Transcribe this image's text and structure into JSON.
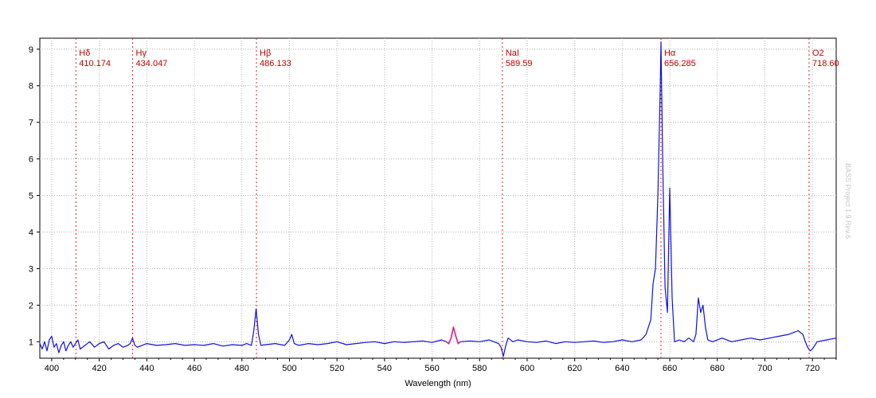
{
  "chart_data": {
    "type": "line",
    "xlabel": "Wavelength (nm)",
    "ylabel": "",
    "xlim": [
      395,
      730
    ],
    "ylim": [
      0.55,
      9.3
    ],
    "grid": true,
    "xticks": [
      400,
      420,
      440,
      460,
      480,
      500,
      520,
      540,
      560,
      580,
      600,
      620,
      640,
      660,
      680,
      700,
      720
    ],
    "yticks": [
      1,
      2,
      3,
      4,
      5,
      6,
      7,
      8,
      9
    ],
    "watermark": "BASS Project 1.9 Rev.6",
    "reference_lines": [
      {
        "name": "Hδ",
        "wavelength_label": "410.174",
        "x": 410.174
      },
      {
        "name": "Hγ",
        "wavelength_label": "434.047",
        "x": 434.047
      },
      {
        "name": "Hβ",
        "wavelength_label": "486.133",
        "x": 486.133
      },
      {
        "name": "NaI",
        "wavelength_label": "589.59",
        "x": 589.59
      },
      {
        "name": "Hα",
        "wavelength_label": "656.285",
        "x": 656.285
      },
      {
        "name": "O2",
        "wavelength_label": "718.60",
        "x": 718.6
      }
    ],
    "series": [
      {
        "x": [
          395,
          396,
          397,
          398,
          399,
          400,
          401,
          402,
          403,
          404,
          405,
          406,
          407,
          408,
          409,
          410,
          411,
          412,
          414,
          416,
          418,
          420,
          422,
          424,
          426,
          428,
          430,
          432,
          433,
          434,
          435,
          436,
          438,
          440,
          444,
          448,
          452,
          456,
          460,
          464,
          468,
          472,
          476,
          480,
          482,
          484,
          485,
          486,
          487,
          488,
          490,
          494,
          498,
          500,
          501,
          502,
          504,
          508,
          512,
          516,
          520,
          524,
          528,
          532,
          536,
          540,
          544,
          548,
          552,
          556,
          560,
          564,
          566,
          567,
          568,
          569,
          570,
          571,
          572,
          576,
          580,
          584,
          586,
          588,
          589,
          590,
          591,
          592,
          594,
          596,
          600,
          604,
          608,
          612,
          616,
          620,
          624,
          628,
          632,
          636,
          640,
          644,
          648,
          650,
          652,
          653,
          654,
          655,
          656,
          656.3,
          657,
          658,
          659,
          660,
          661,
          662,
          664,
          666,
          668,
          670,
          671,
          672,
          673,
          674,
          675,
          676,
          678,
          682,
          686,
          690,
          694,
          698,
          702,
          706,
          710,
          712,
          714,
          716,
          717,
          718,
          719,
          720,
          722,
          726,
          730
        ],
        "values": [
          0.95,
          0.8,
          1.0,
          0.75,
          1.05,
          1.15,
          0.85,
          0.95,
          0.7,
          0.9,
          1.0,
          0.75,
          0.9,
          1.0,
          0.85,
          0.95,
          1.05,
          0.8,
          0.9,
          1.0,
          0.85,
          0.95,
          1.0,
          0.8,
          0.9,
          0.95,
          0.85,
          0.9,
          0.95,
          1.1,
          0.9,
          0.85,
          0.9,
          0.95,
          0.9,
          0.92,
          0.95,
          0.9,
          0.92,
          0.9,
          0.95,
          0.88,
          0.92,
          0.9,
          0.95,
          0.9,
          1.3,
          1.9,
          1.2,
          0.9,
          0.92,
          0.95,
          0.9,
          1.05,
          1.2,
          0.95,
          0.9,
          0.95,
          0.92,
          0.95,
          1.0,
          0.92,
          0.95,
          0.98,
          1.0,
          0.95,
          1.0,
          0.98,
          1.0,
          1.02,
          0.98,
          1.05,
          1.0,
          0.95,
          1.1,
          1.4,
          1.15,
          0.95,
          1.0,
          1.02,
          1.0,
          1.05,
          1.0,
          0.95,
          0.85,
          0.6,
          0.9,
          1.1,
          1.0,
          1.05,
          1.0,
          0.98,
          1.02,
          0.95,
          1.0,
          0.98,
          1.0,
          1.02,
          0.98,
          1.0,
          1.05,
          1.0,
          1.05,
          1.2,
          1.6,
          2.6,
          3.0,
          5.0,
          8.0,
          9.2,
          6.0,
          2.5,
          1.8,
          5.2,
          2.2,
          1.0,
          1.05,
          1.0,
          1.1,
          1.0,
          1.2,
          2.2,
          1.8,
          2.0,
          1.4,
          1.05,
          1.0,
          1.1,
          1.0,
          1.05,
          1.1,
          1.05,
          1.1,
          1.15,
          1.2,
          1.25,
          1.3,
          1.2,
          1.0,
          0.85,
          0.75,
          0.8,
          1.0,
          1.05,
          1.1
        ]
      }
    ],
    "highlight": {
      "x": [
        566,
        567,
        568,
        569,
        570,
        571,
        572
      ],
      "values": [
        1.0,
        0.95,
        1.1,
        1.4,
        1.15,
        0.95,
        1.0
      ]
    }
  }
}
